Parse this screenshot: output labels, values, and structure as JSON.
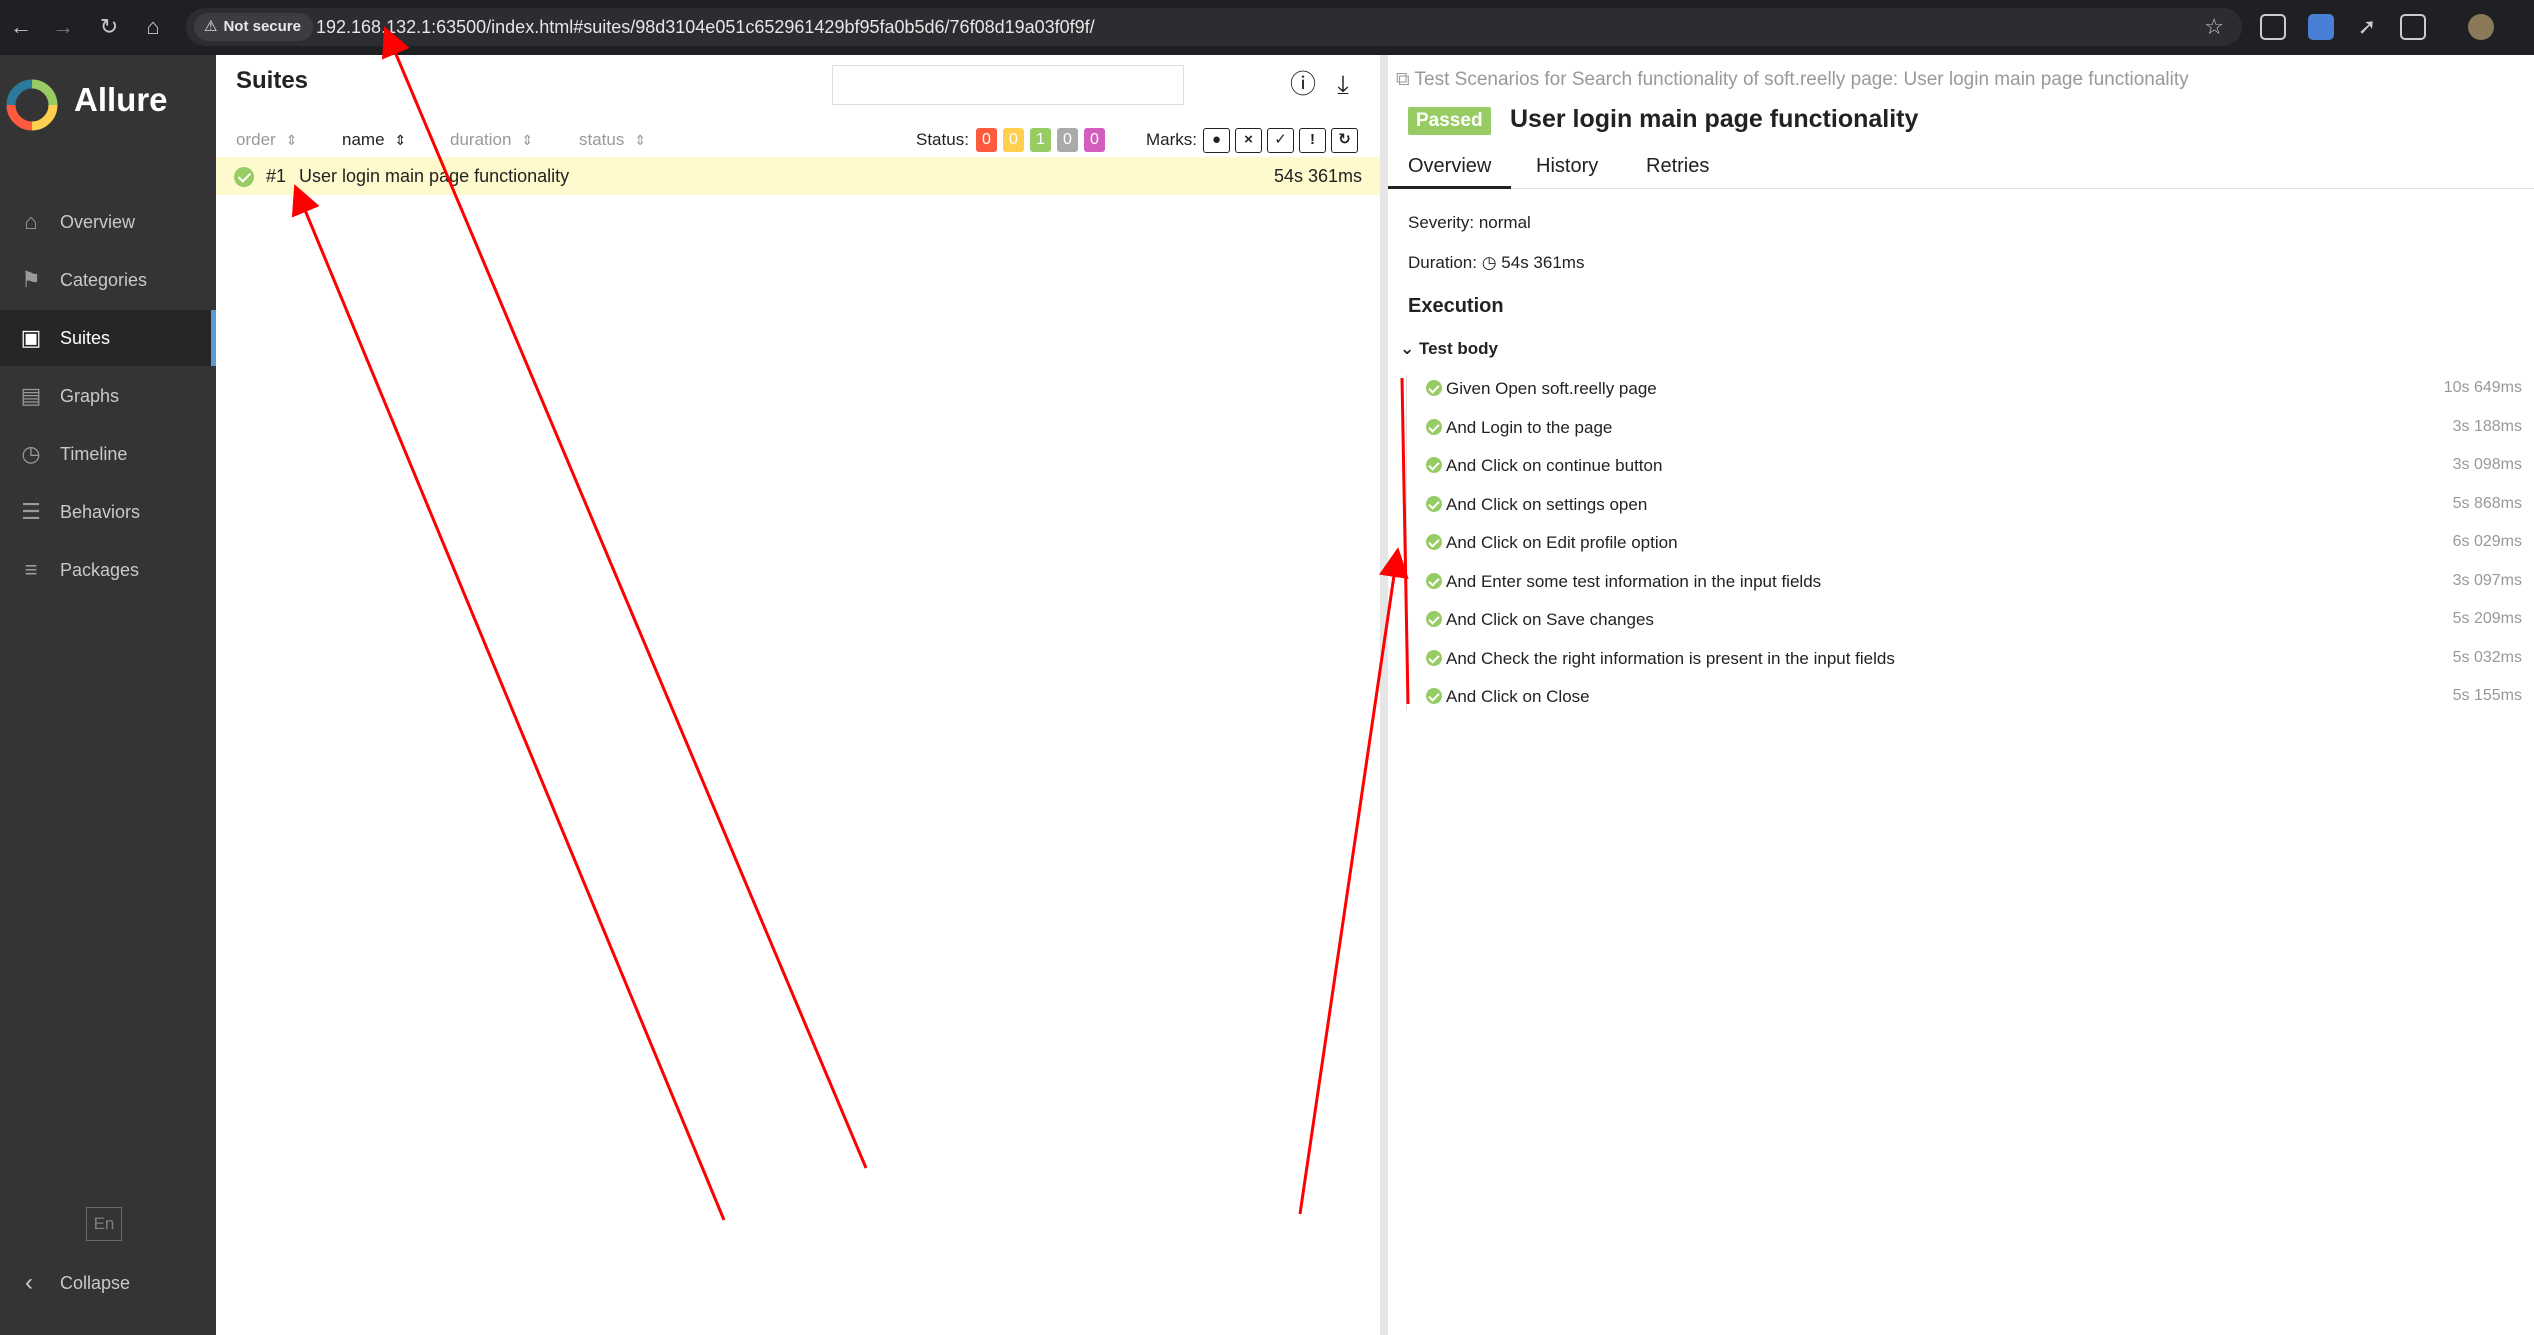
{
  "browser": {
    "security_label": "Not secure",
    "url": "192.168.132.1:63500/index.html#suites/98d3104e051c652961429bf95fa0b5d6/76f08d19a03f0f9f/"
  },
  "sidebar": {
    "brand": "Allure",
    "items": [
      {
        "label": "Overview",
        "icon": "home-icon"
      },
      {
        "label": "Categories",
        "icon": "flag-icon"
      },
      {
        "label": "Suites",
        "icon": "briefcase-icon"
      },
      {
        "label": "Graphs",
        "icon": "bar-chart-icon"
      },
      {
        "label": "Timeline",
        "icon": "clock-icon"
      },
      {
        "label": "Behaviors",
        "icon": "list-icon"
      },
      {
        "label": "Packages",
        "icon": "align-left-icon"
      }
    ],
    "active": "Suites",
    "language": "En",
    "collapse": "Collapse"
  },
  "suites": {
    "title": "Suites",
    "sort_columns": [
      "order",
      "name",
      "duration",
      "status"
    ],
    "status_label": "Status:",
    "status_counts": [
      {
        "value": "0",
        "color": "#fd5a3e"
      },
      {
        "value": "0",
        "color": "#ffd050"
      },
      {
        "value": "1",
        "color": "#97cc64"
      },
      {
        "value": "0",
        "color": "#aaaaaa"
      },
      {
        "value": "0",
        "color": "#d35ebe"
      }
    ],
    "marks_label": "Marks:",
    "rows": [
      {
        "order": "#1",
        "name": "User login main page functionality",
        "duration": "54s 361ms",
        "status": "passed"
      }
    ]
  },
  "detail": {
    "breadcrumb": "Test Scenarios for Search functionality of soft.reelly page: User login main page functionality",
    "status_badge": "Passed",
    "title": "User login main page functionality",
    "tabs": [
      "Overview",
      "History",
      "Retries"
    ],
    "severity": "Severity: normal",
    "duration_label": "Duration:",
    "duration_value": "54s 361ms",
    "execution_heading": "Execution",
    "test_body_label": "Test body",
    "steps": [
      {
        "text": "Given Open soft.reelly page",
        "time": "10s 649ms"
      },
      {
        "text": "And Login to the page",
        "time": "3s 188ms"
      },
      {
        "text": "And Click on continue button",
        "time": "3s 098ms"
      },
      {
        "text": "And Click on settings open",
        "time": "5s 868ms"
      },
      {
        "text": "And Click on Edit profile option",
        "time": "6s 029ms"
      },
      {
        "text": "And Enter some test information in the input fields",
        "time": "3s 097ms"
      },
      {
        "text": "And Click on Save changes",
        "time": "5s 209ms"
      },
      {
        "text": "And Check the right information is present in the input fields",
        "time": "5s 032ms"
      },
      {
        "text": "And Click on Close",
        "time": "5s 155ms"
      }
    ]
  },
  "colors": {
    "accent": "#5a9bd5",
    "passed": "#97cc64",
    "annotation": "#ff0000"
  }
}
